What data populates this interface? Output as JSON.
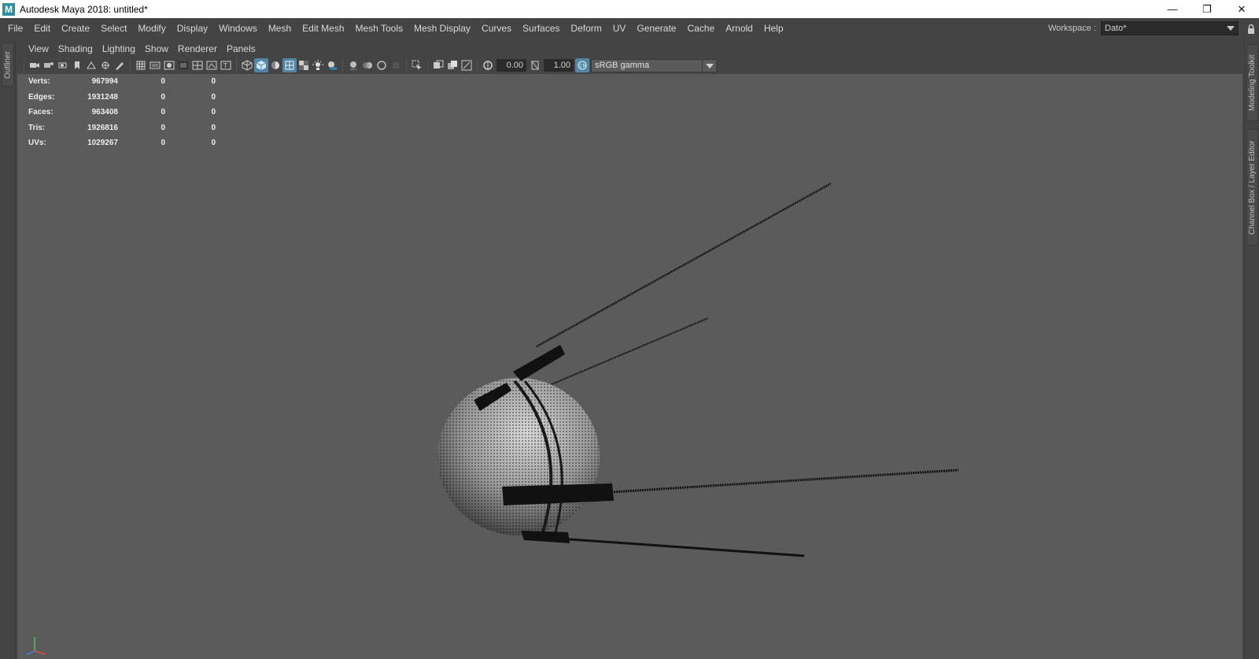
{
  "window": {
    "title": "Autodesk Maya 2018: untitled*",
    "logo": "M",
    "minimize": "—",
    "restore": "❐",
    "close": "✕"
  },
  "menubar": {
    "items": [
      "File",
      "Edit",
      "Create",
      "Select",
      "Modify",
      "Display",
      "Windows",
      "Mesh",
      "Edit Mesh",
      "Mesh Tools",
      "Mesh Display",
      "Curves",
      "Surfaces",
      "Deform",
      "UV",
      "Generate",
      "Cache",
      "Arnold",
      "Help"
    ],
    "workspace_label": "Workspace :",
    "workspace_value": "Dato*"
  },
  "left_strip": {
    "outliner_tab": "Outliner"
  },
  "right_strip": {
    "modeling_toolkit_tab": "Modeling Toolkit",
    "channel_box_tab": "Channel Box / Layer Editor"
  },
  "panel": {
    "menus": [
      "View",
      "Shading",
      "Lighting",
      "Show",
      "Renderer",
      "Panels"
    ],
    "toolbar": {
      "exposure": "0.00",
      "gamma": "1.00",
      "color_space": "sRGB gamma"
    }
  },
  "hud": {
    "rows": [
      {
        "label": "Verts:",
        "v1": "967994",
        "v2": "0",
        "v3": "0"
      },
      {
        "label": "Edges:",
        "v1": "1931248",
        "v2": "0",
        "v3": "0"
      },
      {
        "label": "Faces:",
        "v1": "963408",
        "v2": "0",
        "v3": "0"
      },
      {
        "label": "Tris:",
        "v1": "1926816",
        "v2": "0",
        "v3": "0"
      },
      {
        "label": "UVs:",
        "v1": "1029267",
        "v2": "0",
        "v3": "0"
      }
    ]
  },
  "colors": {
    "accent": "#5285a6",
    "viewport_bg": "#5b5b5b",
    "ui_bg": "#444444"
  }
}
